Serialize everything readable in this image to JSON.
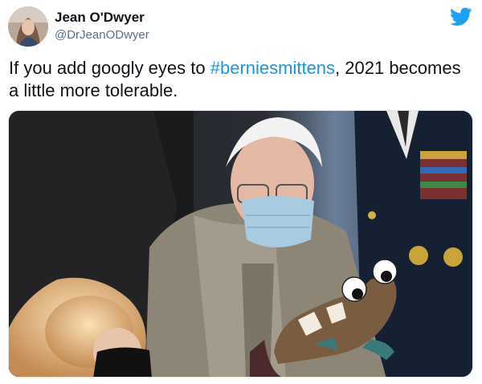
{
  "author": {
    "display_name": "Jean O'Dwyer",
    "handle": "@DrJeanODwyer",
    "avatar_icon": "profile-photo"
  },
  "brand": {
    "icon": "twitter-bird-icon",
    "color": "#1da1f2"
  },
  "tweet": {
    "text_before": "If you add googly eyes to ",
    "hashtag": "#berniesmittens",
    "text_after": ", 2021 becomes a little more tolerable.",
    "hashtag_color": "#1b95e0"
  },
  "media": {
    "type": "photo"
  }
}
